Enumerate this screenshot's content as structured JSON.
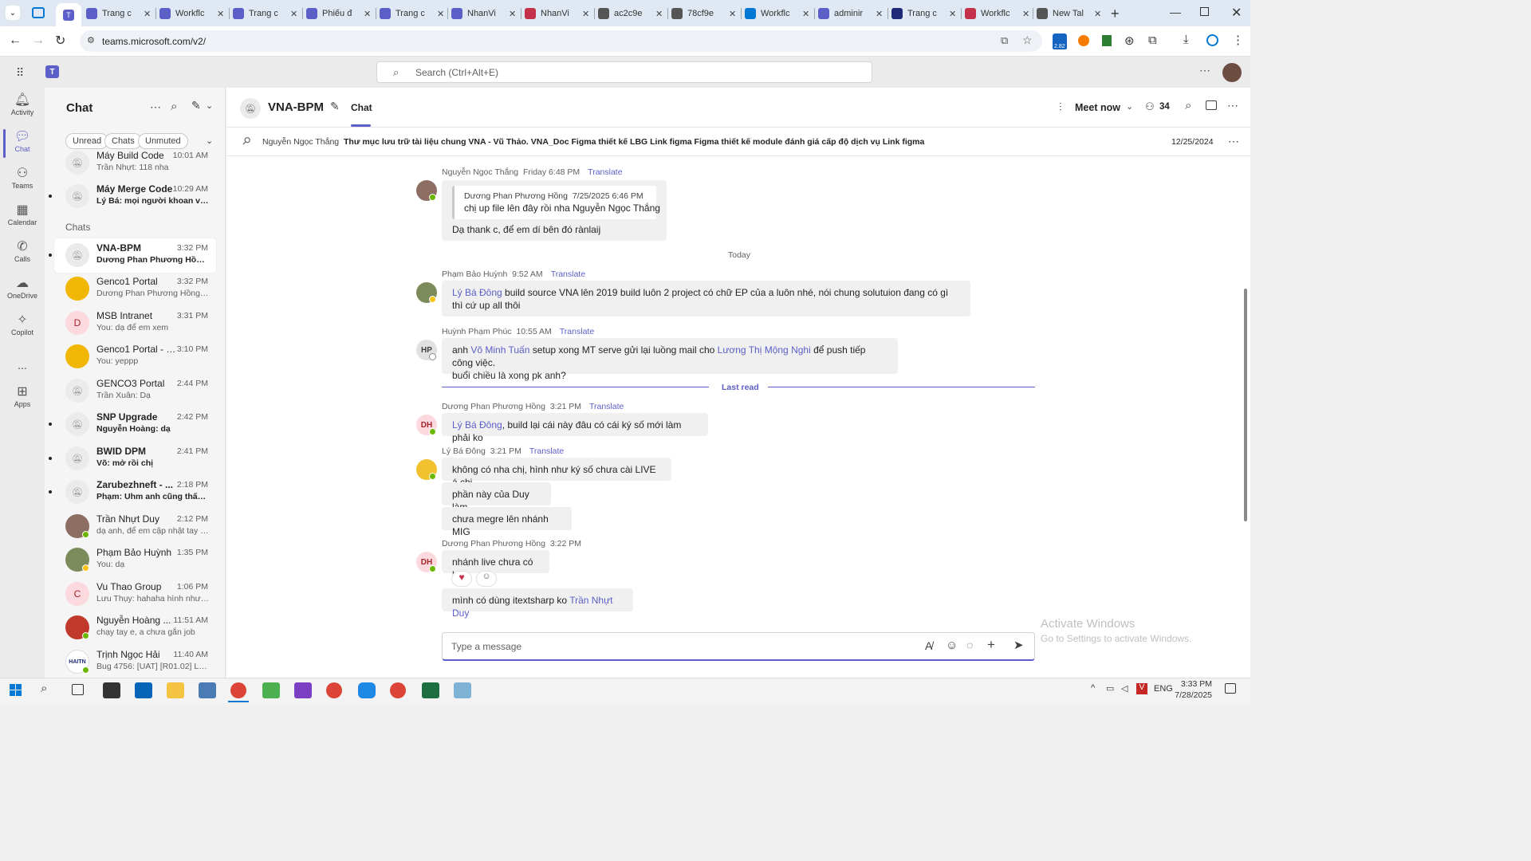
{
  "browser": {
    "tabs": [
      {
        "title": "Trang c",
        "color": "#5b5fc7"
      },
      {
        "title": "Workflc",
        "color": "#5b5fc7"
      },
      {
        "title": "Trang c",
        "color": "#5b5fc7"
      },
      {
        "title": "Phiếu đ",
        "color": "#5b5fc7"
      },
      {
        "title": "Trang c",
        "color": "#5b5fc7"
      },
      {
        "title": "NhanVi",
        "color": "#5b5fc7"
      },
      {
        "title": "NhanVi",
        "color": "#c4314b"
      },
      {
        "title": "ac2c9e",
        "color": "#555"
      },
      {
        "title": "78cf9e",
        "color": "#555"
      },
      {
        "title": "Workflc",
        "color": "#0078d4"
      },
      {
        "title": "adminir",
        "color": "#5b5fc7"
      },
      {
        "title": "Trang c",
        "color": "#1e2a78"
      },
      {
        "title": "Workflc",
        "color": "#c4314b"
      },
      {
        "title": "New Tal",
        "color": "#555"
      }
    ],
    "url": "teams.microsoft.com/v2/",
    "ext_badge": "2.82"
  },
  "teams": {
    "search_placeholder": "Search (Ctrl+Alt+E)",
    "rail": [
      {
        "label": "Activity",
        "icon": "bell-icon"
      },
      {
        "label": "Chat",
        "icon": "chat-icon"
      },
      {
        "label": "Teams",
        "icon": "teams-icon"
      },
      {
        "label": "Calendar",
        "icon": "calendar-icon"
      },
      {
        "label": "Calls",
        "icon": "phone-icon"
      },
      {
        "label": "OneDrive",
        "icon": "cloud-icon"
      },
      {
        "label": "Copilot",
        "icon": "copilot-icon"
      },
      {
        "label": "...",
        "icon": "more-icon"
      },
      {
        "label": "Apps",
        "icon": "apps-icon"
      }
    ],
    "chat_panel": {
      "title": "Chat",
      "filters": [
        "Unread",
        "Chats",
        "Unmuted"
      ],
      "section_chats": "Chats",
      "items": [
        {
          "name": "Máy Build Code",
          "time": "10:01 AM",
          "preview": "Trần Nhựt: 118 nha",
          "avatar": "muted",
          "unread": false
        },
        {
          "name": "Máy Merge Code",
          "time": "10:29 AM",
          "preview": "Lý Bá: mọi người khoan vào ...",
          "avatar": "muted",
          "unread": true
        },
        {
          "name": "VNA-BPM",
          "time": "3:32 PM",
          "preview": "Dương Phan Phương Hồng: a...",
          "avatar": "muted",
          "unread": true,
          "selected": true
        },
        {
          "name": "Genco1 Portal",
          "time": "3:32 PM",
          "preview": "Dương Phan Phương Hồng: sa...",
          "avatar": "group",
          "unread": false
        },
        {
          "name": "MSB Intranet",
          "time": "3:31 PM",
          "preview": "You: dạ để em xem",
          "avatar": "D",
          "unread": false
        },
        {
          "name": "Genco1 Portal - G...",
          "time": "3:10 PM",
          "preview": "You: yeppp",
          "avatar": "group",
          "unread": false
        },
        {
          "name": "GENCO3 Portal",
          "time": "2:44 PM",
          "preview": "Trần Xuân: Dạ",
          "avatar": "muted",
          "unread": false
        },
        {
          "name": "SNP Upgrade",
          "time": "2:42 PM",
          "preview": "Nguyễn Hoàng: dạ",
          "avatar": "muted",
          "unread": true
        },
        {
          "name": "BWID DPM",
          "time": "2:41 PM",
          "preview": "Võ: mở rồi chị",
          "avatar": "muted",
          "unread": true
        },
        {
          "name": "Zarubezhneft - ...",
          "time": "2:18 PM",
          "preview": "Phạm: Uhm anh cũng thấy vậ...",
          "avatar": "muted",
          "unread": true
        },
        {
          "name": "Trần Nhựt Duy",
          "time": "2:12 PM",
          "preview": "dạ anh, để em cập nhật tay từ ...",
          "avatar": "photo",
          "unread": false
        },
        {
          "name": "Phạm Bảo Huỳnh",
          "time": "1:35 PM",
          "preview": "You: dạ",
          "avatar": "photo",
          "unread": false
        },
        {
          "name": "Vu Thao Group",
          "time": "1:06 PM",
          "preview": "Lưu Thụy: hahaha hình như 1/...",
          "avatar": "C",
          "unread": false
        },
        {
          "name": "Nguyễn Hoàng ...",
          "time": "11:51 AM",
          "preview": "chạy tay e, a chưa gắn job",
          "avatar": "photo",
          "unread": false
        },
        {
          "name": "Trịnh Ngọc Hải",
          "time": "11:40 AM",
          "preview": "Bug 4756: [UAT] [R01.02] Lỗi c...",
          "avatar": "HAITN",
          "unread": false
        }
      ]
    },
    "conversation": {
      "title": "VNA-BPM",
      "tab": "Chat",
      "meet_now": "Meet now",
      "participants": "34",
      "pinned": {
        "author": "Nguyễn Ngọc Thắng",
        "text": "Thư mục lưu trữ tài liệu chung VNA - Vũ Thảo. VNA_Doc Figma thiết kế LBG Link figma Figma thiết kế module đánh giá cấp độ dịch vụ Link figma",
        "date": "12/25/2024"
      },
      "translate": "Translate",
      "today": "Today",
      "last_read": "Last read",
      "messages": {
        "m1": {
          "author": "Nguyễn Ngọc Thắng",
          "time": "Friday 6:48 PM",
          "quote_author": "Dương Phan Phương Hồng",
          "quote_time": "7/25/2025 6:46 PM",
          "quote_text": "chị up file lên đây rồi nha Nguyễn Ngọc Thắng",
          "text": "Dạ thank c, để em dí bên đó rànlaij"
        },
        "m2": {
          "author": "Phạm Bảo Huỳnh",
          "time": "9:52 AM",
          "mention": "Lý Bá Đông",
          "text": " build source VNA lên 2019 build luôn 2 project có chữ EP của a luôn nhé, nói chung solutuion đang có gì thì cứ up all thôi"
        },
        "m3": {
          "author": "Huỳnh Phạm Phúc",
          "initials": "HP",
          "time": "10:55 AM",
          "pre": "anh ",
          "mention1": "Võ Minh Tuấn",
          "mid": " setup xong MT serve gửi lại luồng mail cho ",
          "mention2": "Lương Thị Mộng Nghi",
          "post": " để push tiếp công việc.",
          "line2": "buổi chiều là xong pk anh?"
        },
        "m4": {
          "author": "Dương Phan Phương Hồng",
          "initials": "DH",
          "time": "3:21 PM",
          "mention": "Lý Bá Đông",
          "text": ", build lại cái này đâu có cái ký số mới làm phải ko"
        },
        "m5": {
          "author": "Lý Bá Đông",
          "time": "3:21 PM",
          "lines": [
            "không có nha chị, hình như ký số chưa cài LIVE á chị",
            "phần này của Duy làm",
            "chưa megre lên nhánh MIG"
          ]
        },
        "m6": {
          "author": "Dương Phan Phương Hồng",
          "initials": "DH",
          "time": "3:22 PM",
          "text": "nhánh live chưa có hả",
          "text2": "mình có dùng itextsharp ko ",
          "mention": "Trần Nhựt Duy"
        }
      },
      "compose_placeholder": "Type a message"
    }
  },
  "watermark": {
    "line1": "Activate Windows",
    "line2": "Go to Settings to activate Windows."
  },
  "taskbar": {
    "lang": "ENG",
    "time": "3:33 PM",
    "date": "7/28/2025"
  }
}
